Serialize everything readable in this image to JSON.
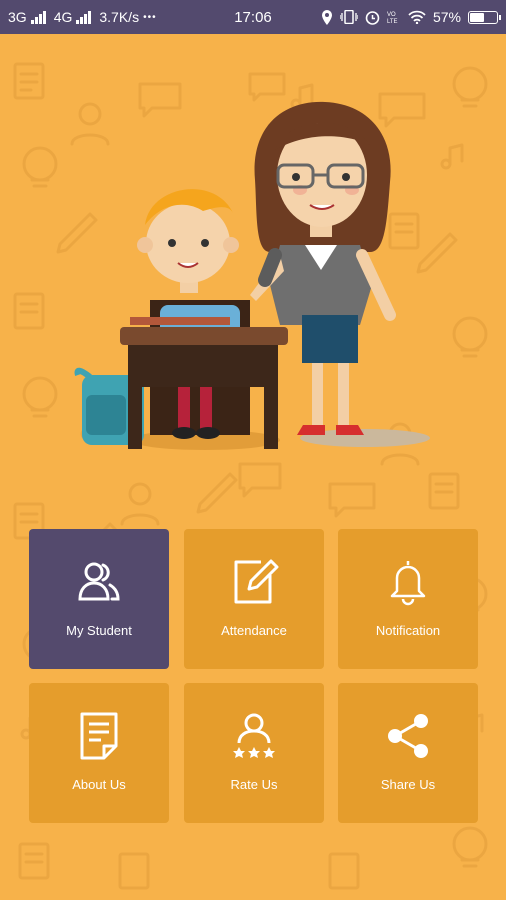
{
  "status_bar": {
    "network_1": "3G",
    "network_2": "4G",
    "speed": "3.7K/s",
    "more": "•••",
    "time": "17:06",
    "battery": "57%",
    "battery_level": 0.57
  },
  "menu": {
    "my_student": "My Student",
    "attendance": "Attendance",
    "notification": "Notification",
    "about_us": "About Us",
    "rate_us": "Rate Us",
    "share_us": "Share Us"
  },
  "colors": {
    "background": "#f7b24a",
    "tile": "#e59d2c",
    "tile_active": "#544a6d",
    "status_bar": "#534a6e"
  }
}
